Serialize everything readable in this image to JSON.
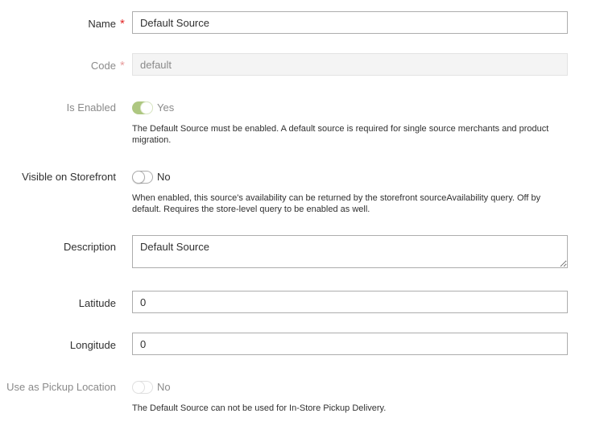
{
  "name": {
    "label": "Name",
    "required_mark": "*",
    "value": "Default Source"
  },
  "code": {
    "label": "Code",
    "required_mark": "*",
    "value": "default"
  },
  "is_enabled": {
    "label": "Is Enabled",
    "toggle_state": "on",
    "toggle_text": "Yes",
    "note": "The Default Source must be enabled. A default source is required for single source merchants and product migration."
  },
  "visible_on_storefront": {
    "label": "Visible on Storefront",
    "toggle_state": "off",
    "toggle_text": "No",
    "note": "When enabled, this source's availability can be returned by the storefront sourceAvailability query. Off by default. Requires the store-level query to be enabled as well."
  },
  "description": {
    "label": "Description",
    "value": "Default Source"
  },
  "latitude": {
    "label": "Latitude",
    "value": "0"
  },
  "longitude": {
    "label": "Longitude",
    "value": "0"
  },
  "use_as_pickup_location": {
    "label": "Use as Pickup Location",
    "toggle_state": "off",
    "toggle_text": "No",
    "note": "The Default Source can not be used for In-Store Pickup Delivery."
  },
  "colors": {
    "required": "#e22626",
    "toggle_on": "#79a22e",
    "input_border": "#adadad",
    "disabled_bg": "#f4f4f4"
  }
}
